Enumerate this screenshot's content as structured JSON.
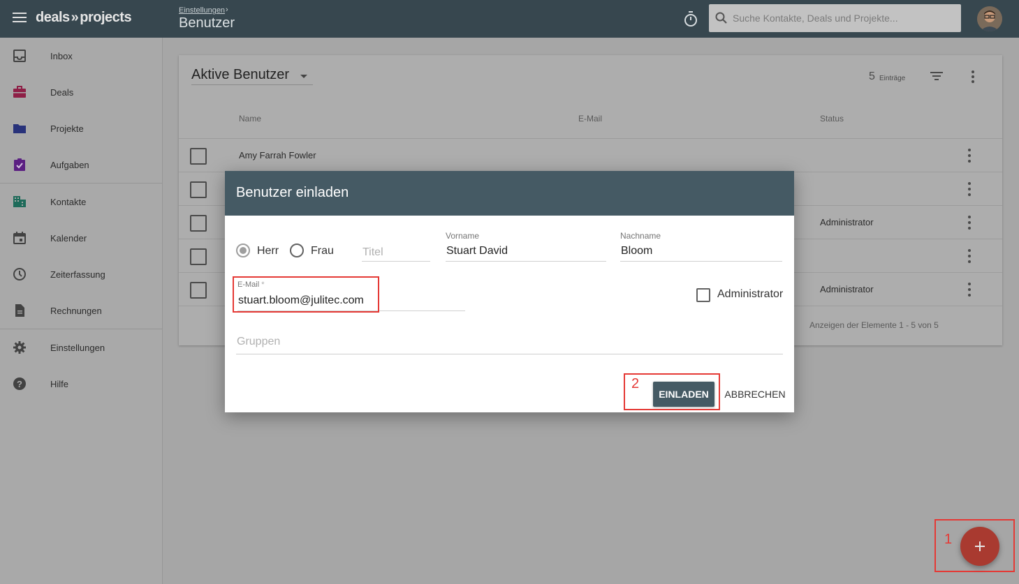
{
  "app": {
    "logo_left": "deals",
    "logo_sep": "»",
    "logo_right": "projects"
  },
  "header": {
    "breadcrumb": "Einstellungen",
    "breadcrumb_sep": "›",
    "title": "Benutzer",
    "search_placeholder": "Suche Kontakte, Deals und Projekte..."
  },
  "sidebar": {
    "items": [
      {
        "label": "Inbox",
        "icon": "inbox-icon",
        "color": "#424242"
      },
      {
        "label": "Deals",
        "icon": "briefcase-icon",
        "color": "#8e1f46"
      },
      {
        "label": "Projekte",
        "icon": "folder-icon",
        "color": "#28327a"
      },
      {
        "label": "Aufgaben",
        "icon": "task-check-icon",
        "color": "#5b1f82"
      },
      {
        "label": "Kontakte",
        "icon": "building-icon",
        "color": "#1e6b5a"
      },
      {
        "label": "Kalender",
        "icon": "calendar-icon",
        "color": "#424242"
      },
      {
        "label": "Zeiterfassung",
        "icon": "clock-icon",
        "color": "#424242"
      },
      {
        "label": "Rechnungen",
        "icon": "document-icon",
        "color": "#424242"
      },
      {
        "label": "Einstellungen",
        "icon": "gear-icon",
        "color": "#424242"
      },
      {
        "label": "Hilfe",
        "icon": "help-icon",
        "color": "#424242"
      }
    ]
  },
  "list": {
    "filter_label": "Aktive Benutzer",
    "count": "5",
    "count_label": "Einträge",
    "columns": {
      "name": "Name",
      "email": "E-Mail",
      "status": "Status"
    },
    "rows": [
      {
        "name": "Amy Farrah Fowler",
        "status": ""
      },
      {
        "name": "",
        "status": ""
      },
      {
        "name": "",
        "status": "Administrator"
      },
      {
        "name": "",
        "status": ""
      },
      {
        "name": "",
        "status": "Administrator"
      }
    ],
    "footer": "Anzeigen der Elemente 1 - 5 von 5"
  },
  "modal": {
    "title": "Benutzer einladen",
    "salutation": {
      "options": [
        "Herr",
        "Frau"
      ],
      "selected": "Herr"
    },
    "title_field_placeholder": "Titel",
    "first_name_label": "Vorname",
    "first_name_value": "Stuart David",
    "last_name_label": "Nachname",
    "last_name_value": "Bloom",
    "email_label": "E-Mail",
    "email_required_mark": "*",
    "email_value": "stuart.bloom@julitec.com",
    "admin_label": "Administrator",
    "groups_placeholder": "Gruppen",
    "invite_button": "EINLADEN",
    "cancel_button": "ABBRECHEN"
  },
  "annotations": {
    "step1": "1",
    "step2": "2",
    "color": "#e53935"
  },
  "fab": {
    "icon": "plus-icon",
    "color": "#a93a30"
  }
}
